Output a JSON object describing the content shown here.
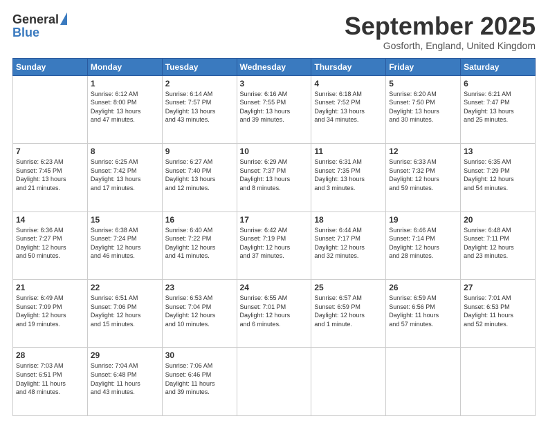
{
  "logo": {
    "general": "General",
    "blue": "Blue"
  },
  "header": {
    "month": "September 2025",
    "location": "Gosforth, England, United Kingdom"
  },
  "weekdays": [
    "Sunday",
    "Monday",
    "Tuesday",
    "Wednesday",
    "Thursday",
    "Friday",
    "Saturday"
  ],
  "weeks": [
    [
      {
        "day": "",
        "info": ""
      },
      {
        "day": "1",
        "info": "Sunrise: 6:12 AM\nSunset: 8:00 PM\nDaylight: 13 hours\nand 47 minutes."
      },
      {
        "day": "2",
        "info": "Sunrise: 6:14 AM\nSunset: 7:57 PM\nDaylight: 13 hours\nand 43 minutes."
      },
      {
        "day": "3",
        "info": "Sunrise: 6:16 AM\nSunset: 7:55 PM\nDaylight: 13 hours\nand 39 minutes."
      },
      {
        "day": "4",
        "info": "Sunrise: 6:18 AM\nSunset: 7:52 PM\nDaylight: 13 hours\nand 34 minutes."
      },
      {
        "day": "5",
        "info": "Sunrise: 6:20 AM\nSunset: 7:50 PM\nDaylight: 13 hours\nand 30 minutes."
      },
      {
        "day": "6",
        "info": "Sunrise: 6:21 AM\nSunset: 7:47 PM\nDaylight: 13 hours\nand 25 minutes."
      }
    ],
    [
      {
        "day": "7",
        "info": "Sunrise: 6:23 AM\nSunset: 7:45 PM\nDaylight: 13 hours\nand 21 minutes."
      },
      {
        "day": "8",
        "info": "Sunrise: 6:25 AM\nSunset: 7:42 PM\nDaylight: 13 hours\nand 17 minutes."
      },
      {
        "day": "9",
        "info": "Sunrise: 6:27 AM\nSunset: 7:40 PM\nDaylight: 13 hours\nand 12 minutes."
      },
      {
        "day": "10",
        "info": "Sunrise: 6:29 AM\nSunset: 7:37 PM\nDaylight: 13 hours\nand 8 minutes."
      },
      {
        "day": "11",
        "info": "Sunrise: 6:31 AM\nSunset: 7:35 PM\nDaylight: 13 hours\nand 3 minutes."
      },
      {
        "day": "12",
        "info": "Sunrise: 6:33 AM\nSunset: 7:32 PM\nDaylight: 12 hours\nand 59 minutes."
      },
      {
        "day": "13",
        "info": "Sunrise: 6:35 AM\nSunset: 7:29 PM\nDaylight: 12 hours\nand 54 minutes."
      }
    ],
    [
      {
        "day": "14",
        "info": "Sunrise: 6:36 AM\nSunset: 7:27 PM\nDaylight: 12 hours\nand 50 minutes."
      },
      {
        "day": "15",
        "info": "Sunrise: 6:38 AM\nSunset: 7:24 PM\nDaylight: 12 hours\nand 46 minutes."
      },
      {
        "day": "16",
        "info": "Sunrise: 6:40 AM\nSunset: 7:22 PM\nDaylight: 12 hours\nand 41 minutes."
      },
      {
        "day": "17",
        "info": "Sunrise: 6:42 AM\nSunset: 7:19 PM\nDaylight: 12 hours\nand 37 minutes."
      },
      {
        "day": "18",
        "info": "Sunrise: 6:44 AM\nSunset: 7:17 PM\nDaylight: 12 hours\nand 32 minutes."
      },
      {
        "day": "19",
        "info": "Sunrise: 6:46 AM\nSunset: 7:14 PM\nDaylight: 12 hours\nand 28 minutes."
      },
      {
        "day": "20",
        "info": "Sunrise: 6:48 AM\nSunset: 7:11 PM\nDaylight: 12 hours\nand 23 minutes."
      }
    ],
    [
      {
        "day": "21",
        "info": "Sunrise: 6:49 AM\nSunset: 7:09 PM\nDaylight: 12 hours\nand 19 minutes."
      },
      {
        "day": "22",
        "info": "Sunrise: 6:51 AM\nSunset: 7:06 PM\nDaylight: 12 hours\nand 15 minutes."
      },
      {
        "day": "23",
        "info": "Sunrise: 6:53 AM\nSunset: 7:04 PM\nDaylight: 12 hours\nand 10 minutes."
      },
      {
        "day": "24",
        "info": "Sunrise: 6:55 AM\nSunset: 7:01 PM\nDaylight: 12 hours\nand 6 minutes."
      },
      {
        "day": "25",
        "info": "Sunrise: 6:57 AM\nSunset: 6:59 PM\nDaylight: 12 hours\nand 1 minute."
      },
      {
        "day": "26",
        "info": "Sunrise: 6:59 AM\nSunset: 6:56 PM\nDaylight: 11 hours\nand 57 minutes."
      },
      {
        "day": "27",
        "info": "Sunrise: 7:01 AM\nSunset: 6:53 PM\nDaylight: 11 hours\nand 52 minutes."
      }
    ],
    [
      {
        "day": "28",
        "info": "Sunrise: 7:03 AM\nSunset: 6:51 PM\nDaylight: 11 hours\nand 48 minutes."
      },
      {
        "day": "29",
        "info": "Sunrise: 7:04 AM\nSunset: 6:48 PM\nDaylight: 11 hours\nand 43 minutes."
      },
      {
        "day": "30",
        "info": "Sunrise: 7:06 AM\nSunset: 6:46 PM\nDaylight: 11 hours\nand 39 minutes."
      },
      {
        "day": "",
        "info": ""
      },
      {
        "day": "",
        "info": ""
      },
      {
        "day": "",
        "info": ""
      },
      {
        "day": "",
        "info": ""
      }
    ]
  ]
}
